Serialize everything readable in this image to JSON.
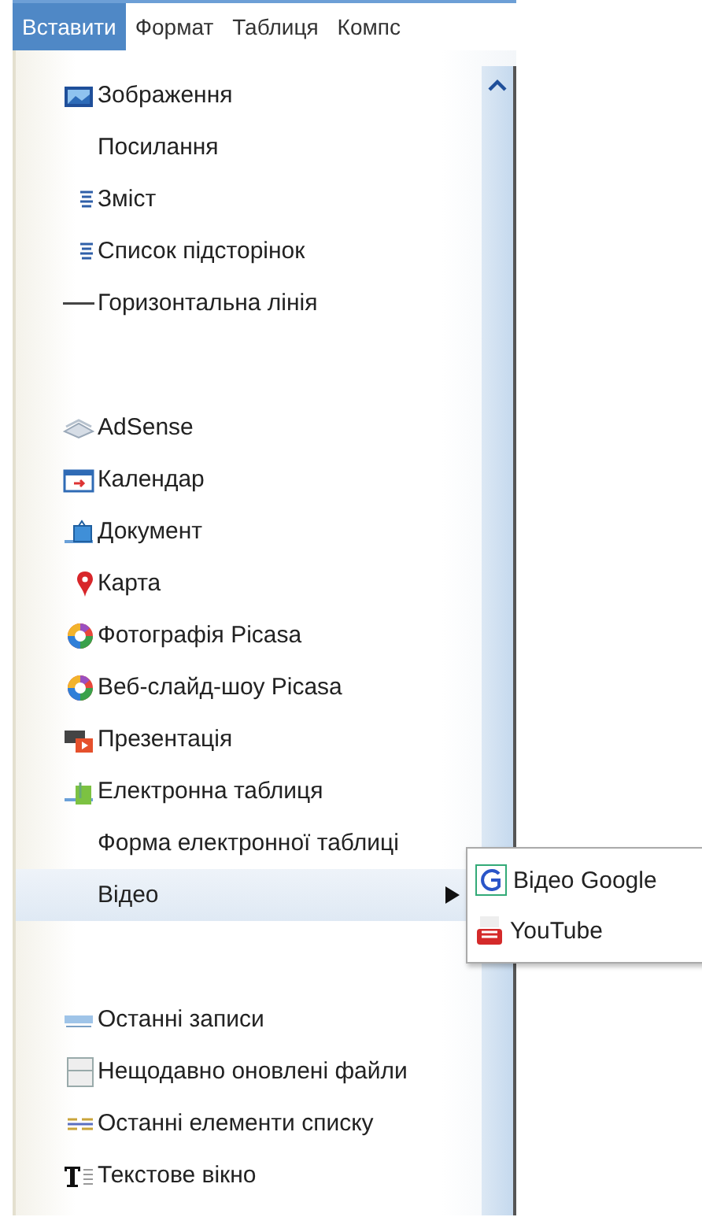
{
  "menu_bar": [
    {
      "label": "Вставити",
      "selected": true
    },
    {
      "label": "Формат",
      "selected": false
    },
    {
      "label": "Таблиця",
      "selected": false
    },
    {
      "label": "Компс",
      "selected": false
    }
  ],
  "menu": {
    "groups": [
      {
        "items": [
          {
            "label": "Зображення",
            "selected": false
          },
          {
            "label": "Посилання",
            "selected": false
          },
          {
            "label": "Зміст",
            "selected": false
          },
          {
            "label": "Список підсторінок",
            "selected": false
          },
          {
            "label": "Горизонтальна лінія",
            "selected": false
          }
        ]
      },
      {
        "items": [
          {
            "label": "AdSense",
            "selected": false
          },
          {
            "label": "Календар",
            "selected": false
          },
          {
            "label": "Документ",
            "selected": false
          },
          {
            "label": "Карта",
            "selected": false
          },
          {
            "label": "Фотографія Picasa",
            "selected": false
          },
          {
            "label": "Веб-слайд-шоу Picasa",
            "selected": false
          },
          {
            "label": "Презентація",
            "selected": false
          },
          {
            "label": "Електронна таблиця",
            "selected": false
          },
          {
            "label": "Форма електронної таблиці",
            "selected": false
          },
          {
            "label": "Відео",
            "selected": true,
            "submenu": [
              {
                "label": "Відео Google"
              },
              {
                "label": "YouTube"
              }
            ]
          }
        ]
      },
      {
        "items": [
          {
            "label": "Останні записи",
            "selected": false
          },
          {
            "label": "Нещодавно оновлені файли",
            "selected": false
          },
          {
            "label": "Останні елементи списку",
            "selected": false
          },
          {
            "label": "Текстове вікно",
            "selected": false
          }
        ]
      }
    ]
  }
}
